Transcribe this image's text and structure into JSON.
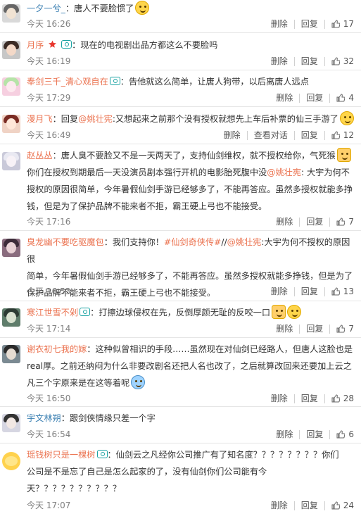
{
  "comments": [
    {
      "user": "一夕一兮_",
      "user_color": "#3a7fb2",
      "before": "：唐人不要脸惯了",
      "emoji": [
        "smiley-emoji"
      ],
      "time": "今天 16:26",
      "delete": "删除",
      "reply": "回复",
      "likes": "17"
    },
    {
      "user": "月序",
      "user_color": "#eb7350",
      "star": true,
      "badge": true,
      "before": "：现在的电视剧出品方都这么不要脸吗",
      "time": "今天 16:19",
      "delete": "删除",
      "reply": "回复",
      "likes": "32"
    },
    {
      "user": "奉剑三千_清心观自在",
      "user_color": "#eb7350",
      "badge": true,
      "before": "：告他就这么简单，让唐人狗带，以后离唐人远点",
      "time": "今天 17:29",
      "delete": "删除",
      "reply": "回复",
      "likes": "4"
    },
    {
      "user": "漫月飞",
      "user_color": "#eb7350",
      "before": "：回复",
      "mention": "@姚壮宪",
      "after": ":又想起来之前那个没有授权就想先上车后补票的仙三手游了",
      "emoji": [
        "smiley-emoji"
      ],
      "time": "今天 16:49",
      "delete": "删除",
      "reply": "查看对话",
      "reply2": "回复",
      "likes": "12"
    },
    {
      "user": "赵丛丛",
      "user_color": "#eb7350",
      "before": "：唐人臭不要脸又不是一天两天了，支持仙剑维权，就不授权给你，气死猴",
      "emoji": [
        "cat-emoji"
      ],
      "after_lines": [
        "你们在授权到期最后一天没演员剧本强行开机的电影胎死腹中没",
        "@姚壮宪",
        ": 大宇为何不",
        "授权的原因很简单，今年暑假仙剑手游已经够多了，不能再答应。虽然多授权就能多挣",
        "钱，但是为了保护品牌不能来者不拒，霸王硬上弓也不能接受。"
      ],
      "time": "今天 17:16",
      "delete": "删除",
      "reply": "回复",
      "likes": "7"
    },
    {
      "user": "臭龙幽不要吃驱魔包",
      "user_color": "#eb7350",
      "before": "：我们支持你！",
      "topic": "#仙剑奇侠传#",
      "mid": "//",
      "mention": "@姚壮宪",
      "lines": [
        ":大宇为何不授权的原因很",
        "简单，今年暑假仙剑手游已经够多了，不能再答应。虽然多授权就能多挣钱，但是为了",
        "保护品牌不能来者不拒，霸王硬上弓也不能接受。"
      ],
      "time": "今天 16:53",
      "delete": "删除",
      "reply": "回复",
      "likes": "13"
    },
    {
      "user": "寒江世雪不剁",
      "user_color": "#eb7350",
      "badge": true,
      "before": "：打擦边球侵权在先，反倒厚颜无耻的反咬一口",
      "emoji": [
        "cat-emoji",
        "smiley-emoji"
      ],
      "time": "今天 17:14",
      "delete": "删除",
      "reply": "回复",
      "likes": "7"
    },
    {
      "user": "谢衣初七我的嫁",
      "user_color": "#eb7350",
      "before": "：这种似曾相识的手段……虽然现在对仙剑已经路人，但唐人这脸也是",
      "lines": [
        "real厚。之前还纳闷为什么非要改剧名还把人名也改了，之后就算改回来还要加上云之",
        "凡三个字原来是在这等着呢"
      ],
      "emoji": [
        "sweat-emoji"
      ],
      "time": "今天 16:50",
      "delete": "删除",
      "reply": "回复",
      "likes": "28"
    },
    {
      "user": "宇文林朔",
      "user_color": "#3a7fb2",
      "before": "：跟剑侠情缘只差一个字",
      "time": "今天 16:54",
      "delete": "删除",
      "reply": "回复",
      "likes": "6"
    },
    {
      "user": "瑶钱树只是一棵树",
      "user_color": "#eb7350",
      "badge": true,
      "before": "：仙剑云之凡经你公司推广有了知名度？？？？？？？？你们",
      "lines": [
        "公司是不是忘了自己是怎么起家的了，没有仙剑你们公司能有今",
        "天？？？？？？？？？？"
      ],
      "time": "今天 17:07",
      "delete": "删除",
      "reply": "回复",
      "likes": "24"
    }
  ],
  "colors": {
    "accent": "#eb7350",
    "link": "#3a7fb2",
    "meta": "#808080"
  }
}
